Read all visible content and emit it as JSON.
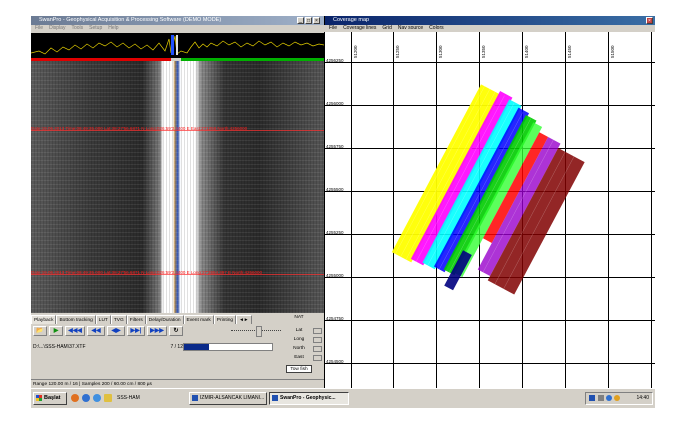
{
  "left_window": {
    "title": "SwanPro - Geophysical Acquisition & Processing Software (DEMO MODE)",
    "controls": [
      "_",
      "□",
      "×"
    ],
    "menu": [
      "File",
      "Display",
      "Tools",
      "Setup",
      "Help"
    ],
    "annotations": [
      "Date:19.06.2013 Time:08:49:35.000 Lat:38:27'56.6871 N Long:026:59'3.4400 E  East:271258 North:4256000",
      "Date:19.06.2013 Time:08:49:35.000 Lat:38:27'56.6871 N Long:026:59'3.4400 E  Long:27'2654.397 E North:4256000"
    ],
    "tabs": [
      "Playback",
      "Bottom tracking",
      "LUT",
      "TVG",
      "Filters",
      "Delay/Duration",
      "Event mark",
      "Printing"
    ],
    "tab_scroll": "◄►",
    "playback_buttons": [
      {
        "name": "open-folder",
        "glyph": "📂"
      },
      {
        "name": "play",
        "glyph": "▶"
      },
      {
        "name": "rewind-fast",
        "glyph": "◀◀◀"
      },
      {
        "name": "rewind",
        "glyph": "◀◀"
      },
      {
        "name": "step",
        "glyph": "◀▶"
      },
      {
        "name": "forward",
        "glyph": "▶▶|"
      },
      {
        "name": "forward-fast",
        "glyph": "▶▶▶"
      },
      {
        "name": "loop",
        "glyph": "↻"
      }
    ],
    "file_path": "D:\\...\\SSS-HAM\\37.XTF",
    "file_count": "7 / 12",
    "progress_fraction": 0.28,
    "nav": {
      "title": "NAT",
      "labels": [
        "Lat",
        "Long",
        "North",
        "East"
      ],
      "towfish_label": "Tow fish"
    },
    "status": "Range 120.00 m / 16 | Samples 200 / 60.00 cm / 800 µs"
  },
  "right_window": {
    "title": "Coverage map",
    "controls": [
      "×"
    ],
    "menu": [
      "File",
      "Coverage lines",
      "Grid",
      "Nav source",
      "Colors"
    ],
    "x_ticks": [
      "51200",
      "51250",
      "51300",
      "51350",
      "51400",
      "51450",
      "51500"
    ],
    "y_ticks": [
      "4256250",
      "4256000",
      "4255750",
      "4255500",
      "4255250",
      "4255000",
      "4254750",
      "4254500"
    ],
    "swath_colors": [
      "#ffff00",
      "#ff00ff",
      "#00ffff",
      "#0000ff",
      "#00cc00",
      "#ff0000",
      "#800000",
      "#9900cc"
    ]
  },
  "taskbar": {
    "start_label": "Başlat",
    "quicklaunch_label": "SSS-HAM",
    "tasks": [
      {
        "label": "IZMIR-ALSANCAK LIMANI...",
        "active": false
      },
      {
        "label": "SwanPro - Geophysic...",
        "active": true
      }
    ],
    "clock": "14:40"
  }
}
